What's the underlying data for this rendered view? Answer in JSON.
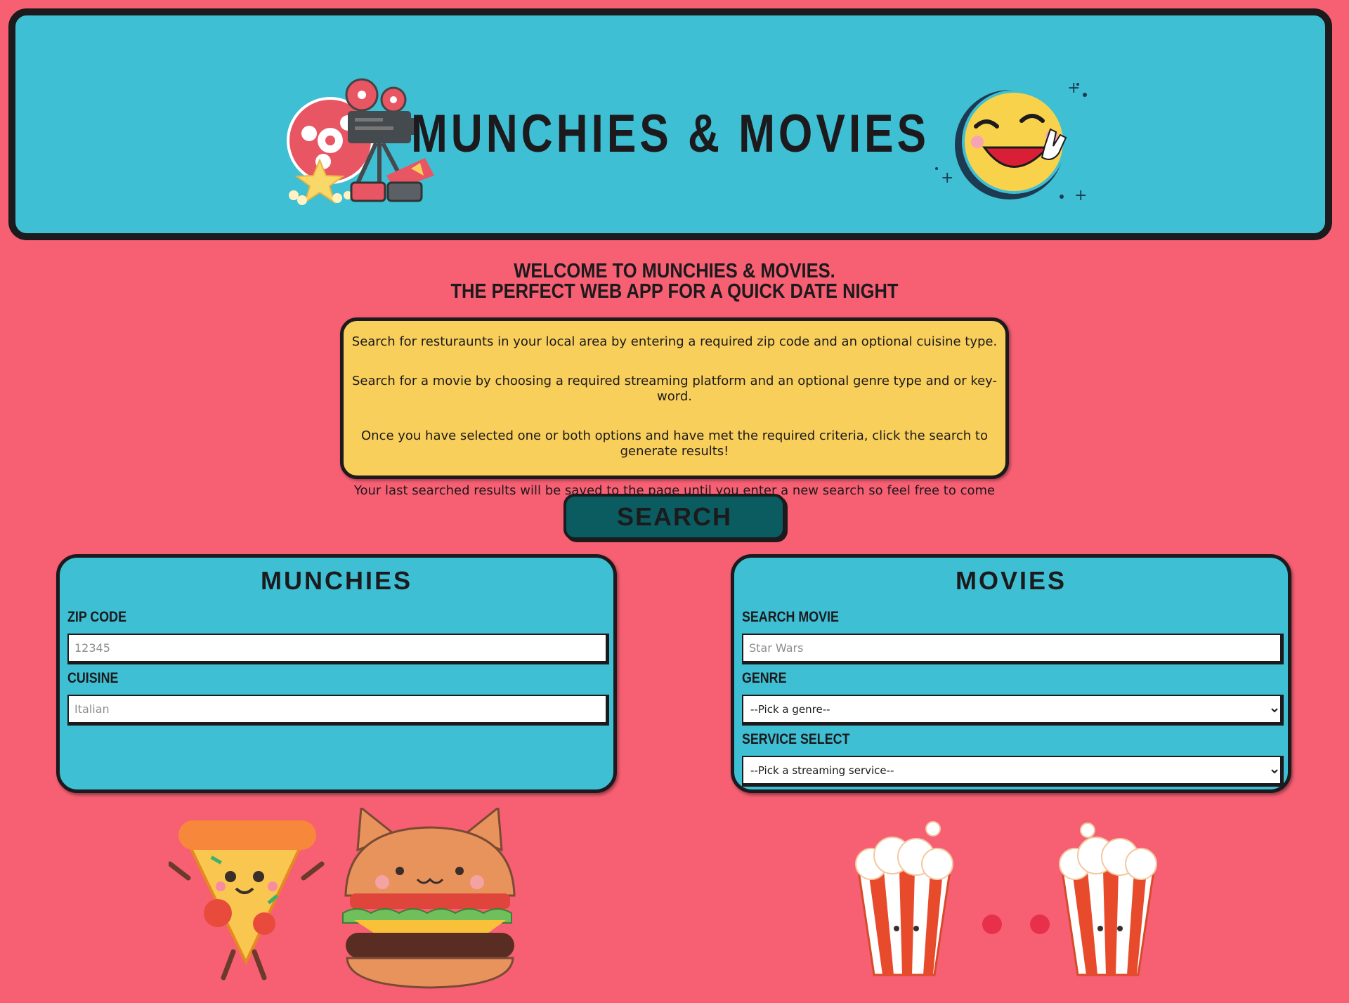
{
  "header": {
    "title": "MUNCHIES & MOVIES"
  },
  "welcome": {
    "line1": "Welcome to Munchies & Movies.",
    "line2": "The perfect web app for a quick date night"
  },
  "info": {
    "p1": "Search for resturaunts in your local area by entering a required zip code and an optional cuisine type.",
    "p2": "Search for a movie by choosing a required streaming platform and an optional genre type and or key-word.",
    "p3": "Once you have selected one or both options and have met the required criteria, click the search to generate results!",
    "p4": "Your last searched results will be saved to the page until you enter a new search so feel free to come back later!"
  },
  "search_button": {
    "label": "SEARCH"
  },
  "munchies": {
    "title": "Munchies",
    "zip_label": "Zip Code",
    "zip_placeholder": "12345",
    "cuisine_label": "Cuisine",
    "cuisine_placeholder": "Italian"
  },
  "movies": {
    "title": "Movies",
    "search_label": "Search Movie",
    "search_placeholder": "Star Wars",
    "genre_label": "Genre",
    "genre_selected": "--Pick a genre--",
    "service_label": "Service Select",
    "service_selected": "--Pick a streaming service--"
  },
  "colors": {
    "background": "#f75f73",
    "panel": "#3ebfd4",
    "info": "#f9cf5b",
    "button": "#0b5c61",
    "border": "#1c1a1c"
  },
  "icons": [
    "film-projector-icon",
    "laughing-emoji-icon",
    "pizza-character-icon",
    "cat-burger-character-icon",
    "popcorn-couple-icon"
  ]
}
